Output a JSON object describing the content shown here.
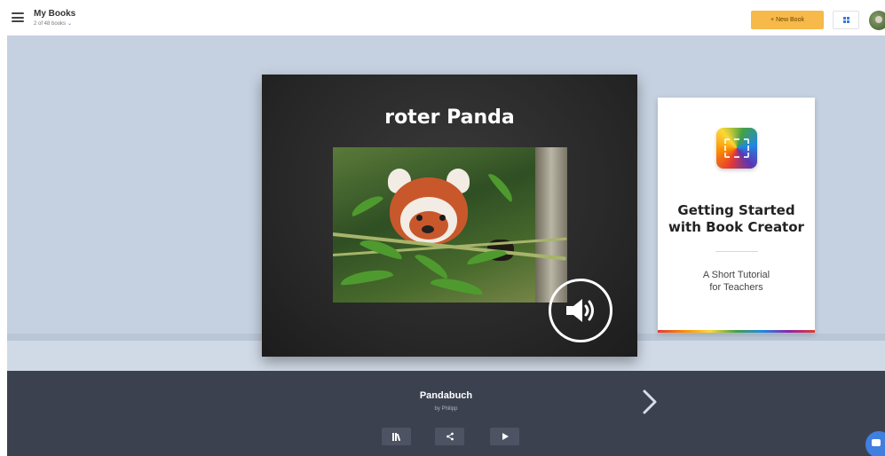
{
  "header": {
    "title": "My Books",
    "book_count": "2 of 48 books",
    "new_book_label": "+ New Book",
    "accent_color": "#f6b94a",
    "icons": [
      "menu-icon",
      "chevron-down-icon",
      "grid-view-icon",
      "avatar"
    ]
  },
  "shelf": {
    "background_color": "#c5d1e0",
    "books": [
      {
        "cover_title": "roter Panda",
        "cover_image": "red panda photo",
        "has_audio": true
      },
      {
        "cover_title_line1": "Getting Started",
        "cover_title_line2": "with Book Creator",
        "cover_subtitle_line1": "A Short Tutorial",
        "cover_subtitle_line2": "for Teachers"
      }
    ]
  },
  "info_bar": {
    "book_title": "Pandabuch",
    "author": "by Philipp",
    "background_color": "#3c4150",
    "actions": [
      "library-icon",
      "share-icon",
      "play-icon"
    ],
    "next_icon": "chevron-right-icon"
  },
  "chat": {
    "icon": "chat-icon",
    "color": "#3f7fe0"
  }
}
